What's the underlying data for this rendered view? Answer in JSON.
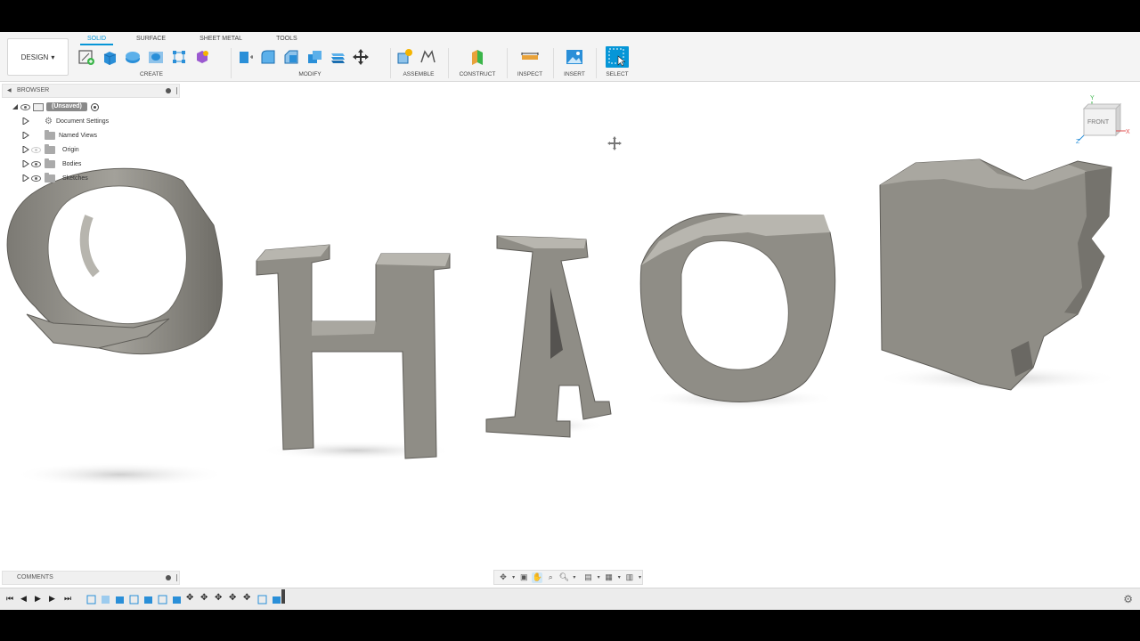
{
  "toolbar": {
    "workspace": "DESIGN",
    "tabs": [
      "SOLID",
      "SURFACE",
      "SHEET METAL",
      "TOOLS"
    ],
    "groups": {
      "create": "CREATE",
      "modify": "MODIFY",
      "assemble": "ASSEMBLE",
      "construct": "CONSTRUCT",
      "inspect": "INSPECT",
      "insert": "INSERT",
      "select": "SELECT"
    },
    "accent": "#0696d7"
  },
  "browser": {
    "title": "BROWSER",
    "root": "(Unsaved)",
    "items": [
      {
        "label": "Document Settings",
        "icon": "gear-icon"
      },
      {
        "label": "Named Views",
        "icon": "folder-icon"
      },
      {
        "label": "Origin",
        "icon": "folder-icon"
      },
      {
        "label": "Bodies",
        "icon": "folder-icon"
      },
      {
        "label": "Sketches",
        "icon": "folder-icon"
      }
    ]
  },
  "viewcube": {
    "face": "FRONT",
    "x_axis": "X",
    "y_axis": "Y",
    "z_axis": "Z"
  },
  "comments": {
    "title": "COMMENTS"
  },
  "model": {
    "color": "#8f8d86",
    "shadow": "#d9d9d9"
  }
}
